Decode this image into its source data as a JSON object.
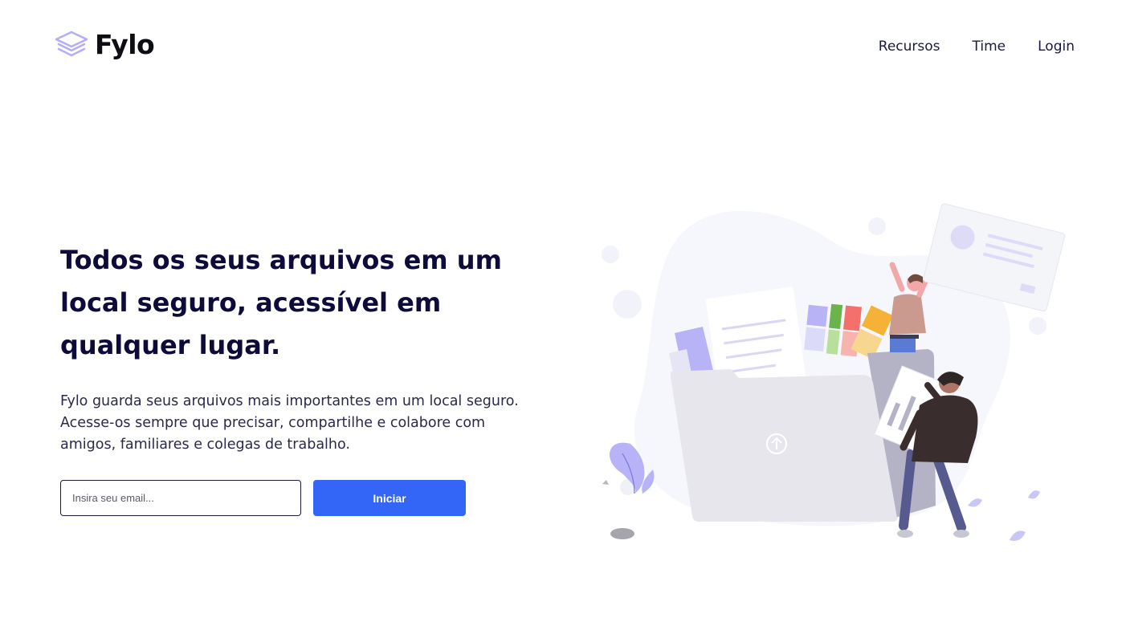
{
  "brand": {
    "name": "Fylo",
    "logo_icon": "stacked-layers-icon",
    "logo_color": "#a9a3f8"
  },
  "nav": {
    "items": [
      {
        "label": "Recursos"
      },
      {
        "label": "Time"
      },
      {
        "label": "Login"
      }
    ]
  },
  "hero": {
    "title": "Todos os seus arquivos em um local seguro, acessível em qualquer lugar.",
    "description": "Fylo guarda seus arquivos mais importantes em um local seguro. Acesse-os sempre que precisar, compartilhe e colabore com amigos, familiares e colegas de trabalho.",
    "email_placeholder": "Insira seu email...",
    "email_value": "",
    "cta_label": "Iniciar",
    "illustration_icon": "file-upload-illustration"
  },
  "colors": {
    "accent": "#3366f6",
    "heading": "#0c0b3a",
    "text": "#2a2949",
    "illustration_blob": "#f6f6fd"
  }
}
